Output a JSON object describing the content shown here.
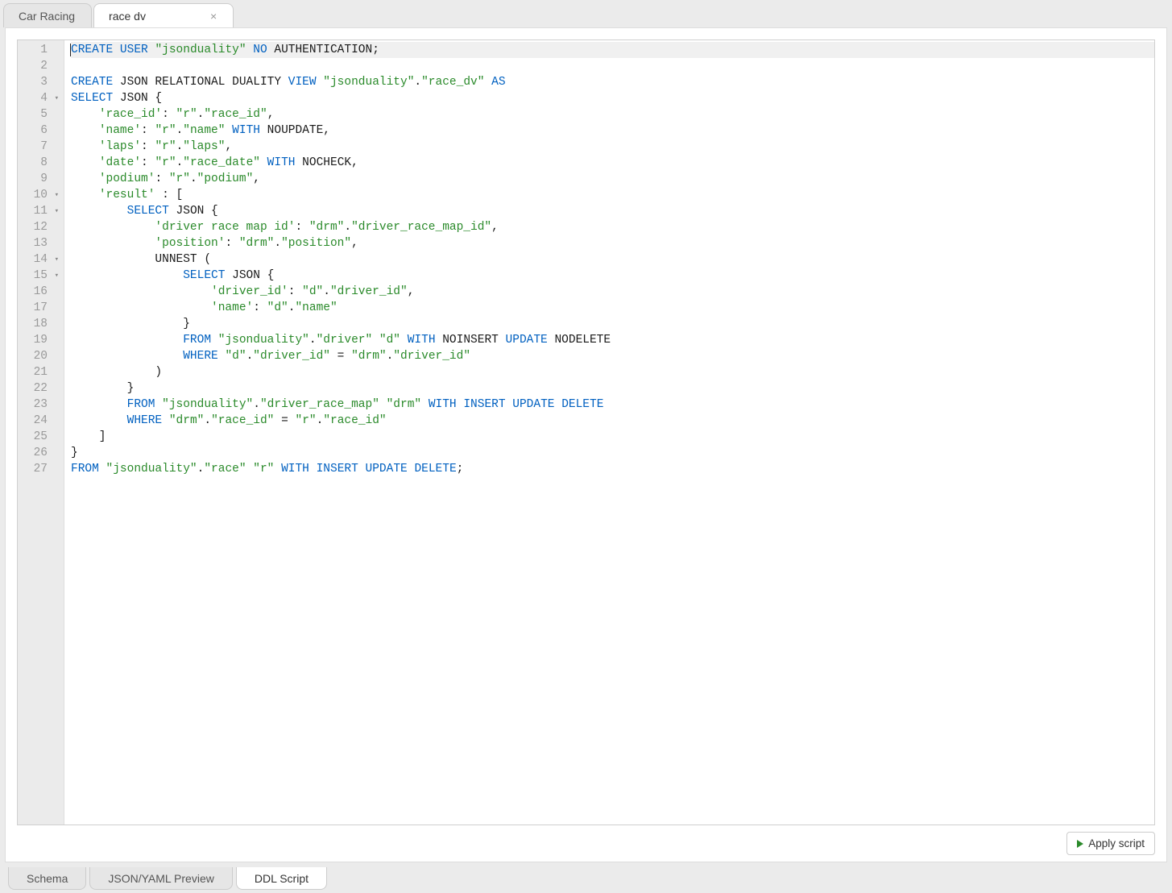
{
  "top_tabs": [
    {
      "label": "Car Racing",
      "active": false,
      "closable": false
    },
    {
      "label": "race dv",
      "active": true,
      "closable": true
    }
  ],
  "bottom_tabs": [
    {
      "label": "Schema",
      "active": false
    },
    {
      "label": "JSON/YAML Preview",
      "active": false
    },
    {
      "label": "DDL Script",
      "active": true
    }
  ],
  "apply_button_label": "Apply script",
  "code_lines": [
    {
      "n": 1,
      "fold": false,
      "hl": true,
      "tokens": [
        {
          "t": "CREATE",
          "c": "kw"
        },
        {
          "t": " "
        },
        {
          "t": "USER",
          "c": "kw"
        },
        {
          "t": " "
        },
        {
          "t": "\"jsonduality\"",
          "c": "str"
        },
        {
          "t": " "
        },
        {
          "t": "NO",
          "c": "kw"
        },
        {
          "t": " AUTHENTICATION;"
        }
      ]
    },
    {
      "n": 2,
      "fold": false,
      "tokens": [
        {
          "t": ""
        }
      ]
    },
    {
      "n": 3,
      "fold": false,
      "tokens": [
        {
          "t": "CREATE",
          "c": "kw"
        },
        {
          "t": " JSON RELATIONAL DUALITY "
        },
        {
          "t": "VIEW",
          "c": "kw"
        },
        {
          "t": " "
        },
        {
          "t": "\"jsonduality\"",
          "c": "str"
        },
        {
          "t": "."
        },
        {
          "t": "\"race_dv\"",
          "c": "str"
        },
        {
          "t": " "
        },
        {
          "t": "AS",
          "c": "kw"
        }
      ]
    },
    {
      "n": 4,
      "fold": true,
      "tokens": [
        {
          "t": "SELECT",
          "c": "kw"
        },
        {
          "t": " JSON {"
        }
      ]
    },
    {
      "n": 5,
      "fold": false,
      "tokens": [
        {
          "t": "    "
        },
        {
          "t": "'race_id'",
          "c": "str"
        },
        {
          "t": ": "
        },
        {
          "t": "\"r\"",
          "c": "str"
        },
        {
          "t": "."
        },
        {
          "t": "\"race_id\"",
          "c": "str"
        },
        {
          "t": ","
        }
      ]
    },
    {
      "n": 6,
      "fold": false,
      "tokens": [
        {
          "t": "    "
        },
        {
          "t": "'name'",
          "c": "str"
        },
        {
          "t": ": "
        },
        {
          "t": "\"r\"",
          "c": "str"
        },
        {
          "t": "."
        },
        {
          "t": "\"name\"",
          "c": "str"
        },
        {
          "t": " "
        },
        {
          "t": "WITH",
          "c": "kw"
        },
        {
          "t": " NOUPDATE,"
        }
      ]
    },
    {
      "n": 7,
      "fold": false,
      "tokens": [
        {
          "t": "    "
        },
        {
          "t": "'laps'",
          "c": "str"
        },
        {
          "t": ": "
        },
        {
          "t": "\"r\"",
          "c": "str"
        },
        {
          "t": "."
        },
        {
          "t": "\"laps\"",
          "c": "str"
        },
        {
          "t": ","
        }
      ]
    },
    {
      "n": 8,
      "fold": false,
      "tokens": [
        {
          "t": "    "
        },
        {
          "t": "'date'",
          "c": "str"
        },
        {
          "t": ": "
        },
        {
          "t": "\"r\"",
          "c": "str"
        },
        {
          "t": "."
        },
        {
          "t": "\"race_date\"",
          "c": "str"
        },
        {
          "t": " "
        },
        {
          "t": "WITH",
          "c": "kw"
        },
        {
          "t": " NOCHECK,"
        }
      ]
    },
    {
      "n": 9,
      "fold": false,
      "tokens": [
        {
          "t": "    "
        },
        {
          "t": "'podium'",
          "c": "str"
        },
        {
          "t": ": "
        },
        {
          "t": "\"r\"",
          "c": "str"
        },
        {
          "t": "."
        },
        {
          "t": "\"podium\"",
          "c": "str"
        },
        {
          "t": ","
        }
      ]
    },
    {
      "n": 10,
      "fold": true,
      "tokens": [
        {
          "t": "    "
        },
        {
          "t": "'result'",
          "c": "str"
        },
        {
          "t": " : ["
        }
      ]
    },
    {
      "n": 11,
      "fold": true,
      "tokens": [
        {
          "t": "        "
        },
        {
          "t": "SELECT",
          "c": "kw"
        },
        {
          "t": " JSON {"
        }
      ]
    },
    {
      "n": 12,
      "fold": false,
      "tokens": [
        {
          "t": "            "
        },
        {
          "t": "'driver race map id'",
          "c": "str"
        },
        {
          "t": ": "
        },
        {
          "t": "\"drm\"",
          "c": "str"
        },
        {
          "t": "."
        },
        {
          "t": "\"driver_race_map_id\"",
          "c": "str"
        },
        {
          "t": ","
        }
      ]
    },
    {
      "n": 13,
      "fold": false,
      "tokens": [
        {
          "t": "            "
        },
        {
          "t": "'position'",
          "c": "str"
        },
        {
          "t": ": "
        },
        {
          "t": "\"drm\"",
          "c": "str"
        },
        {
          "t": "."
        },
        {
          "t": "\"position\"",
          "c": "str"
        },
        {
          "t": ","
        }
      ]
    },
    {
      "n": 14,
      "fold": true,
      "tokens": [
        {
          "t": "            UNNEST ("
        }
      ]
    },
    {
      "n": 15,
      "fold": true,
      "tokens": [
        {
          "t": "                "
        },
        {
          "t": "SELECT",
          "c": "kw"
        },
        {
          "t": " JSON {"
        }
      ]
    },
    {
      "n": 16,
      "fold": false,
      "tokens": [
        {
          "t": "                    "
        },
        {
          "t": "'driver_id'",
          "c": "str"
        },
        {
          "t": ": "
        },
        {
          "t": "\"d\"",
          "c": "str"
        },
        {
          "t": "."
        },
        {
          "t": "\"driver_id\"",
          "c": "str"
        },
        {
          "t": ","
        }
      ]
    },
    {
      "n": 17,
      "fold": false,
      "tokens": [
        {
          "t": "                    "
        },
        {
          "t": "'name'",
          "c": "str"
        },
        {
          "t": ": "
        },
        {
          "t": "\"d\"",
          "c": "str"
        },
        {
          "t": "."
        },
        {
          "t": "\"name\"",
          "c": "str"
        }
      ]
    },
    {
      "n": 18,
      "fold": false,
      "tokens": [
        {
          "t": "                }"
        }
      ]
    },
    {
      "n": 19,
      "fold": false,
      "tokens": [
        {
          "t": "                "
        },
        {
          "t": "FROM",
          "c": "kw"
        },
        {
          "t": " "
        },
        {
          "t": "\"jsonduality\"",
          "c": "str"
        },
        {
          "t": "."
        },
        {
          "t": "\"driver\"",
          "c": "str"
        },
        {
          "t": " "
        },
        {
          "t": "\"d\"",
          "c": "str"
        },
        {
          "t": " "
        },
        {
          "t": "WITH",
          "c": "kw"
        },
        {
          "t": " NOINSERT "
        },
        {
          "t": "UPDATE",
          "c": "kw"
        },
        {
          "t": " NODELETE"
        }
      ]
    },
    {
      "n": 20,
      "fold": false,
      "tokens": [
        {
          "t": "                "
        },
        {
          "t": "WHERE",
          "c": "kw"
        },
        {
          "t": " "
        },
        {
          "t": "\"d\"",
          "c": "str"
        },
        {
          "t": "."
        },
        {
          "t": "\"driver_id\"",
          "c": "str"
        },
        {
          "t": " = "
        },
        {
          "t": "\"drm\"",
          "c": "str"
        },
        {
          "t": "."
        },
        {
          "t": "\"driver_id\"",
          "c": "str"
        }
      ]
    },
    {
      "n": 21,
      "fold": false,
      "tokens": [
        {
          "t": "            )"
        }
      ]
    },
    {
      "n": 22,
      "fold": false,
      "tokens": [
        {
          "t": "        }"
        }
      ]
    },
    {
      "n": 23,
      "fold": false,
      "tokens": [
        {
          "t": "        "
        },
        {
          "t": "FROM",
          "c": "kw"
        },
        {
          "t": " "
        },
        {
          "t": "\"jsonduality\"",
          "c": "str"
        },
        {
          "t": "."
        },
        {
          "t": "\"driver_race_map\"",
          "c": "str"
        },
        {
          "t": " "
        },
        {
          "t": "\"drm\"",
          "c": "str"
        },
        {
          "t": " "
        },
        {
          "t": "WITH",
          "c": "kw"
        },
        {
          "t": " "
        },
        {
          "t": "INSERT",
          "c": "kw"
        },
        {
          "t": " "
        },
        {
          "t": "UPDATE",
          "c": "kw"
        },
        {
          "t": " "
        },
        {
          "t": "DELETE",
          "c": "kw"
        }
      ]
    },
    {
      "n": 24,
      "fold": false,
      "tokens": [
        {
          "t": "        "
        },
        {
          "t": "WHERE",
          "c": "kw"
        },
        {
          "t": " "
        },
        {
          "t": "\"drm\"",
          "c": "str"
        },
        {
          "t": "."
        },
        {
          "t": "\"race_id\"",
          "c": "str"
        },
        {
          "t": " = "
        },
        {
          "t": "\"r\"",
          "c": "str"
        },
        {
          "t": "."
        },
        {
          "t": "\"race_id\"",
          "c": "str"
        }
      ]
    },
    {
      "n": 25,
      "fold": false,
      "tokens": [
        {
          "t": "    ]"
        }
      ]
    },
    {
      "n": 26,
      "fold": false,
      "tokens": [
        {
          "t": "}"
        }
      ]
    },
    {
      "n": 27,
      "fold": false,
      "tokens": [
        {
          "t": "FROM",
          "c": "kw"
        },
        {
          "t": " "
        },
        {
          "t": "\"jsonduality\"",
          "c": "str"
        },
        {
          "t": "."
        },
        {
          "t": "\"race\"",
          "c": "str"
        },
        {
          "t": " "
        },
        {
          "t": "\"r\"",
          "c": "str"
        },
        {
          "t": " "
        },
        {
          "t": "WITH",
          "c": "kw"
        },
        {
          "t": " "
        },
        {
          "t": "INSERT",
          "c": "kw"
        },
        {
          "t": " "
        },
        {
          "t": "UPDATE",
          "c": "kw"
        },
        {
          "t": " "
        },
        {
          "t": "DELETE",
          "c": "kw"
        },
        {
          "t": ";"
        }
      ]
    }
  ]
}
